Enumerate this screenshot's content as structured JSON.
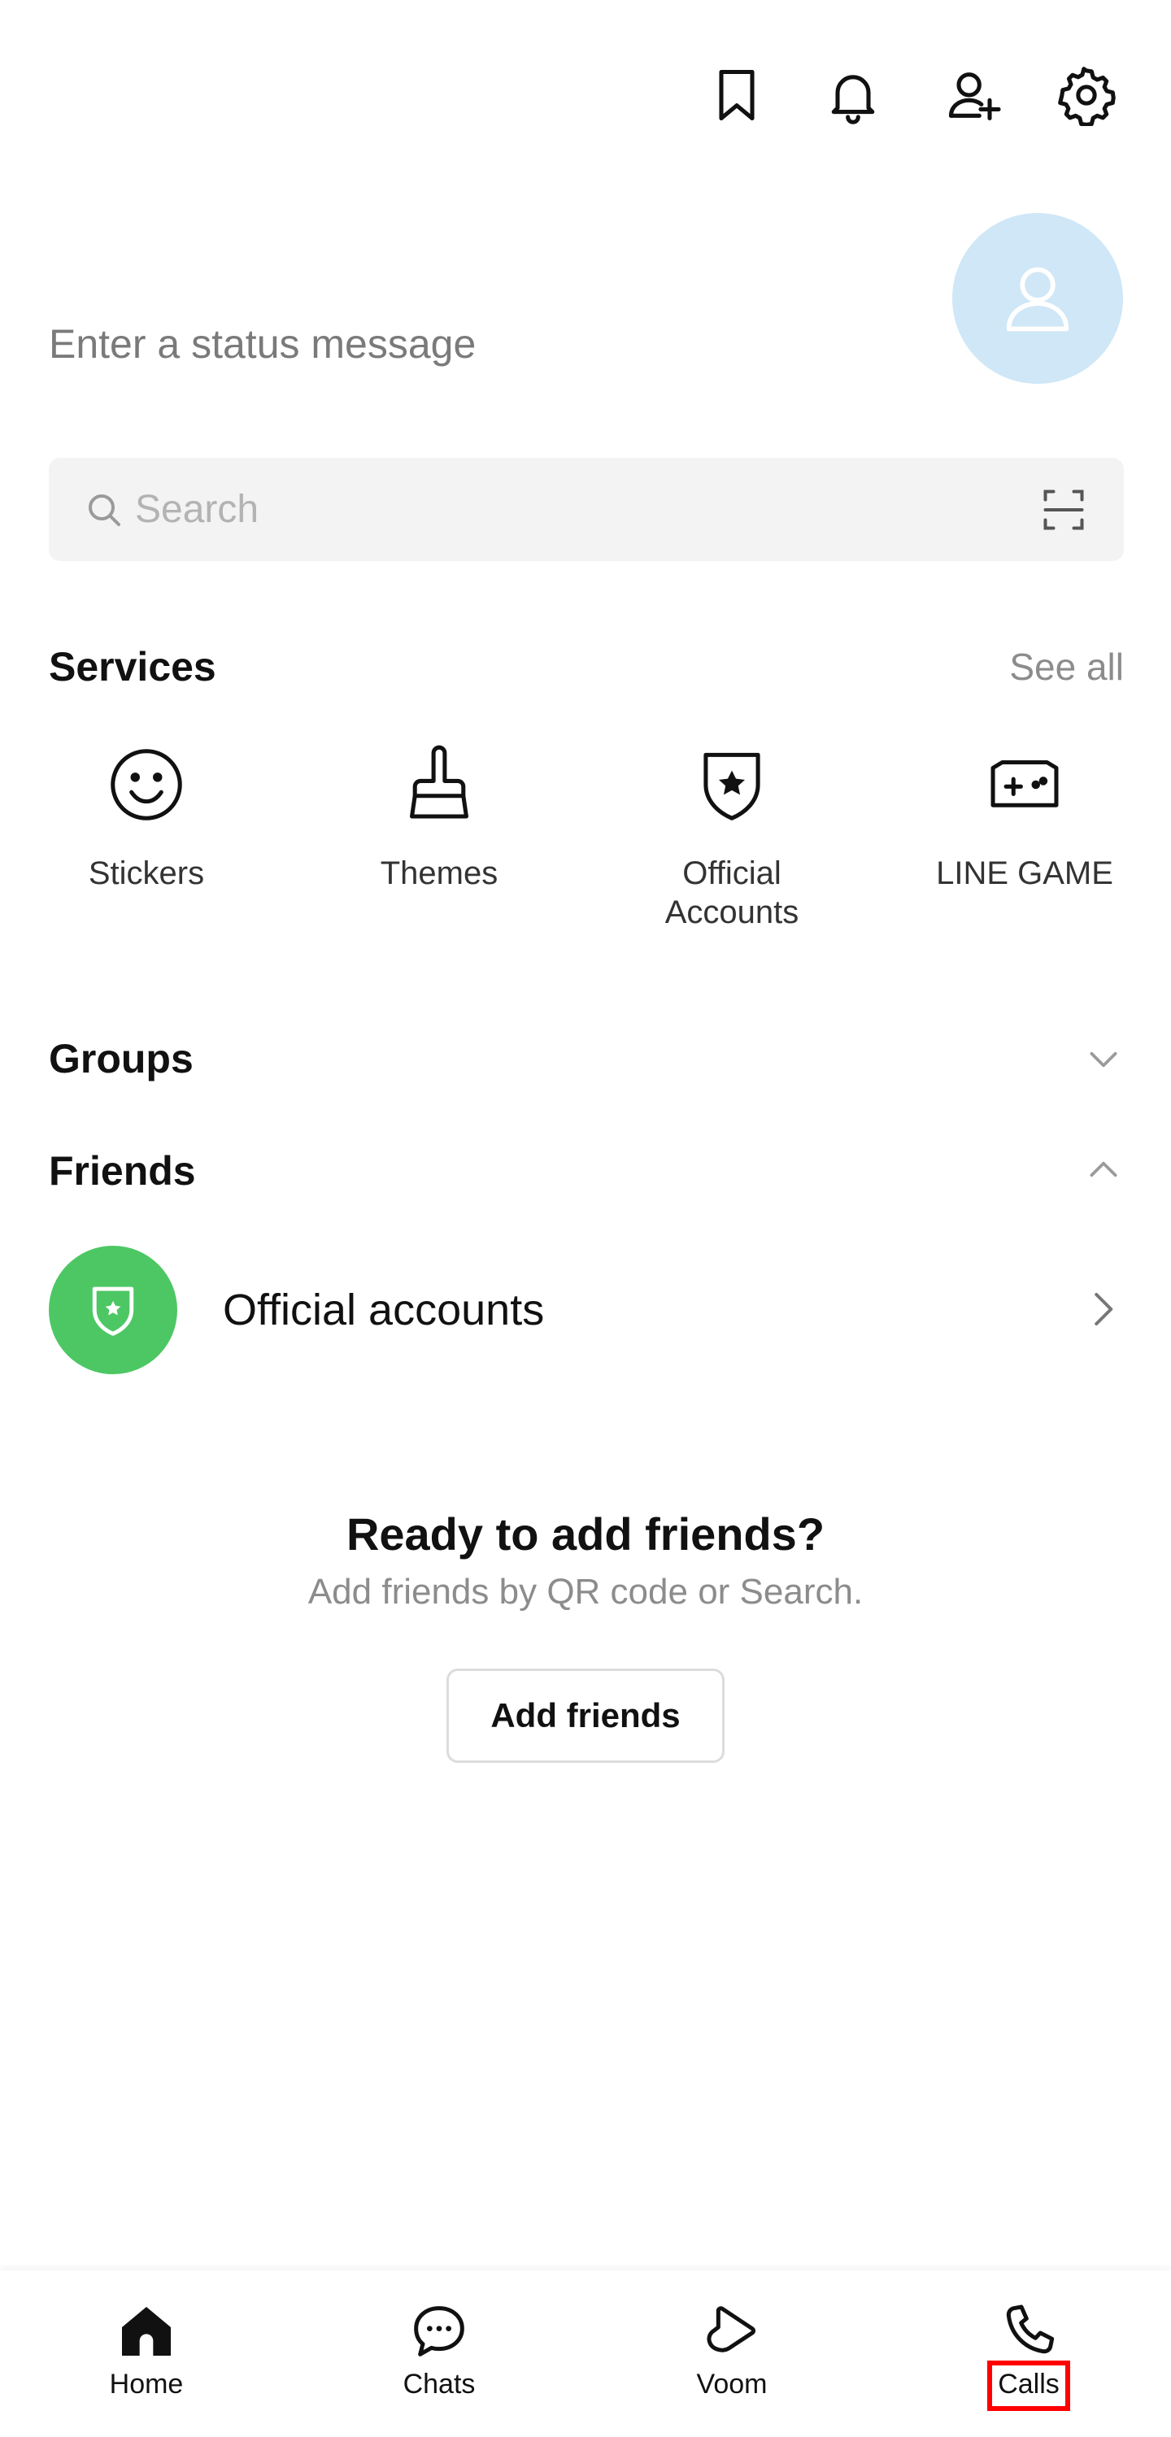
{
  "header": {
    "icons": [
      "bookmark-icon",
      "bell-icon",
      "add-friend-icon",
      "settings-icon"
    ]
  },
  "profile": {
    "status_placeholder": "Enter a status message",
    "avatar_color": "#cfe7f7"
  },
  "search": {
    "placeholder": "Search"
  },
  "services": {
    "title": "Services",
    "see_all": "See all",
    "items": [
      {
        "label": "Stickers",
        "icon": "smiley-icon"
      },
      {
        "label": "Themes",
        "icon": "brush-icon"
      },
      {
        "label_line1": "Official",
        "label_line2": "Accounts",
        "icon": "shield-star-icon"
      },
      {
        "label": "LINE GAME",
        "icon": "gamepad-icon"
      }
    ]
  },
  "groups": {
    "title": "Groups",
    "expanded": false
  },
  "friends": {
    "title": "Friends",
    "expanded": true,
    "official_accounts_label": "Official accounts",
    "accent_color": "#4cc764"
  },
  "empty_state": {
    "title": "Ready to add friends?",
    "subtitle": "Add friends by QR code or Search.",
    "button": "Add friends"
  },
  "bottom_nav": {
    "items": [
      {
        "label": "Home",
        "icon": "home-icon",
        "active": true
      },
      {
        "label": "Chats",
        "icon": "chat-icon",
        "active": false
      },
      {
        "label": "Voom",
        "icon": "voom-icon",
        "active": false
      },
      {
        "label": "Calls",
        "icon": "phone-icon",
        "active": false,
        "highlighted": true
      }
    ]
  },
  "highlight_color": "#ff0000"
}
